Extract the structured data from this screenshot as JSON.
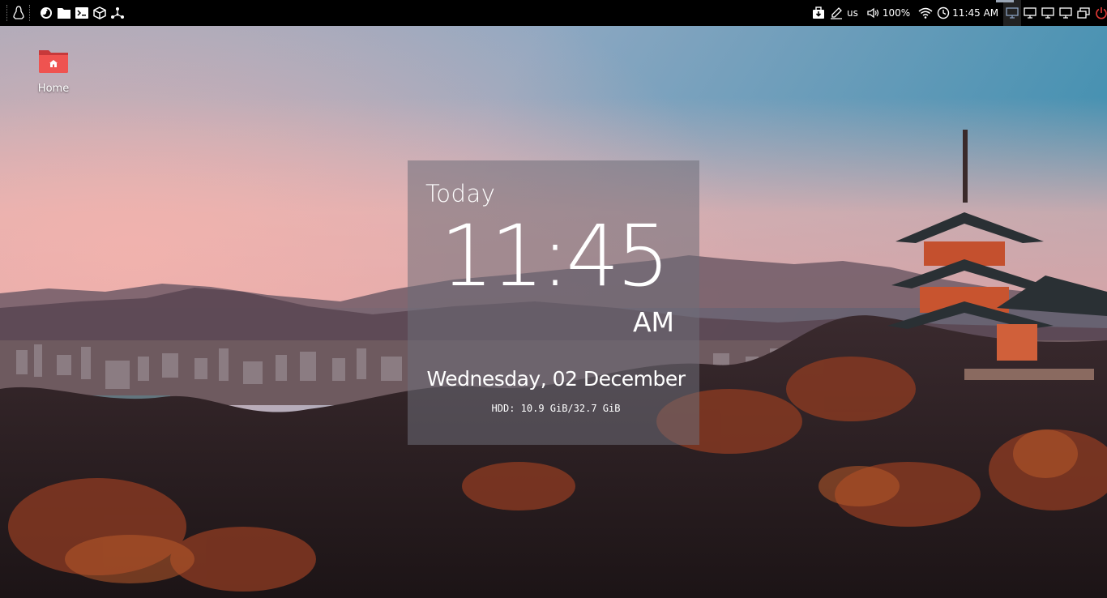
{
  "desktop": {
    "icons": [
      {
        "label": "Home",
        "icon": "home-folder-icon"
      }
    ]
  },
  "panel": {
    "launchers": [
      "linux-menu-icon",
      "firefox-icon",
      "files-icon",
      "terminal-icon",
      "package-icon",
      "network-graph-icon"
    ],
    "tray": {
      "keyboard_layout": "us",
      "volume": "100%",
      "clock": "11:45 AM"
    },
    "workspaces": 5,
    "accent_color": "#e53935"
  },
  "widget": {
    "heading": "Today",
    "time": "11:45",
    "ampm": "AM",
    "date": "Wednesday, 02 December",
    "hdd": "HDD: 10.9 GiB/32.7 GiB"
  }
}
